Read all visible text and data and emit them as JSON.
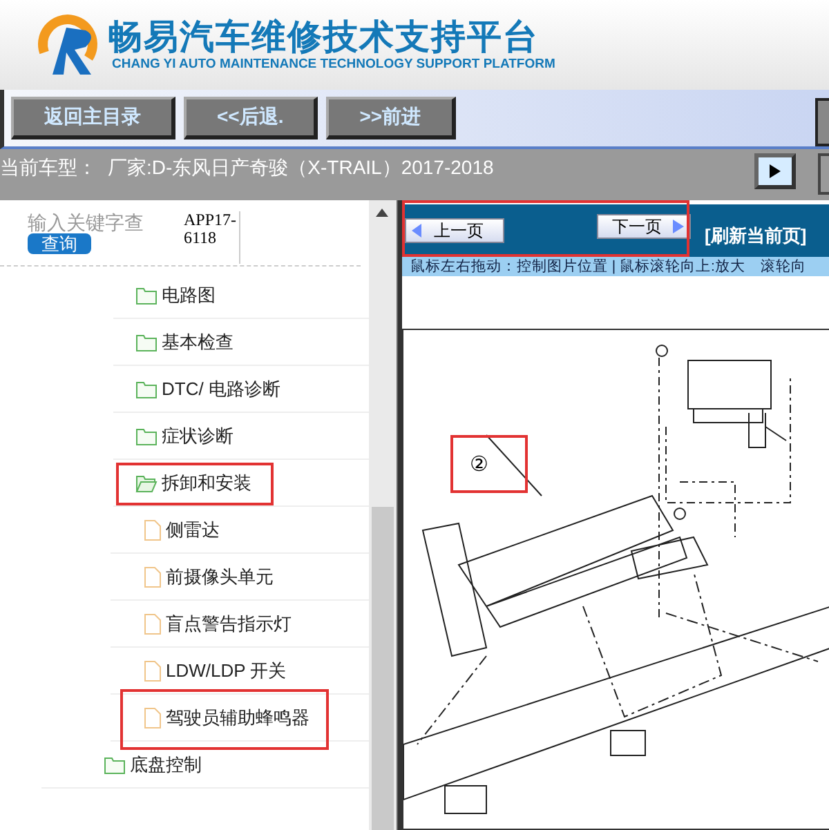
{
  "header": {
    "title": "畅易汽车维修技术支持平台",
    "subtitle": "CHANG YI AUTO MAINTENANCE TECHNOLOGY SUPPORT PLATFORM"
  },
  "toolbar": {
    "buttons": [
      "返回主目录",
      "<<后退.",
      ">>前进"
    ]
  },
  "model_bar": {
    "label": "当前车型：",
    "value": "厂家:D-东风日产奇骏（X-TRAIL）2017-2018"
  },
  "search": {
    "placeholder": "输入关键字查",
    "button": "查询",
    "code": "APP17-6118"
  },
  "tree": [
    {
      "children": [
        {
          "label": "电路图",
          "kind": "folder",
          "expanded": false,
          "highlighted": false
        },
        {
          "label": "基本检查",
          "kind": "folder",
          "expanded": false,
          "highlighted": false
        },
        {
          "label": "DTC/ 电路诊断",
          "kind": "folder",
          "expanded": false,
          "highlighted": false
        },
        {
          "label": "症状诊断",
          "kind": "folder",
          "expanded": false,
          "highlighted": false
        },
        {
          "label": "拆卸和安装",
          "kind": "folder",
          "expanded": true,
          "highlighted": true,
          "children": [
            {
              "label": "侧雷达",
              "kind": "document",
              "highlighted": false
            },
            {
              "label": "前摄像头单元",
              "kind": "document",
              "highlighted": false
            },
            {
              "label": "盲点警告指示灯",
              "kind": "document",
              "highlighted": false
            },
            {
              "label": "LDW/LDP 开关",
              "kind": "document",
              "highlighted": false
            },
            {
              "label": "驾驶员辅助蜂鸣器",
              "kind": "document",
              "highlighted": true
            }
          ]
        }
      ]
    },
    {
      "label": "底盘控制",
      "kind": "folder",
      "expanded": false,
      "highlighted": false
    }
  ],
  "viewer": {
    "prev": "上一页",
    "next": "下一页",
    "refresh": "[刷新当前页]",
    "nav_highlighted": true,
    "hint": "鼠标左右拖动：控制图片位置 | 鼠标滚轮向上:放大　滚轮向",
    "callout": "②",
    "callout_highlighted": true
  }
}
